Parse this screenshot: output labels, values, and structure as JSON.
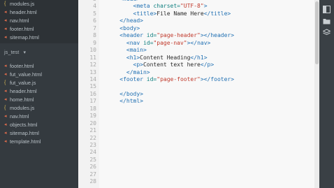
{
  "sidebar": {
    "group1_files": [
      {
        "name": "modules.js",
        "type": "js"
      },
      {
        "name": "header.html",
        "type": "html"
      },
      {
        "name": "nav.html",
        "type": "html"
      },
      {
        "name": "footer.html",
        "type": "html"
      },
      {
        "name": "sitemap.html",
        "type": "html"
      }
    ],
    "group2": {
      "title": "js_test",
      "chevron": "▾",
      "files": [
        {
          "name": "footer.html",
          "type": "html"
        },
        {
          "name": "fut_value.html",
          "type": "html"
        },
        {
          "name": "fut_value.js",
          "type": "js"
        },
        {
          "name": "header.html",
          "type": "html"
        },
        {
          "name": "home.html",
          "type": "html"
        },
        {
          "name": "modules.js",
          "type": "js"
        },
        {
          "name": "nav.html",
          "type": "html"
        },
        {
          "name": "objects.html",
          "type": "html"
        },
        {
          "name": "sitemap.html",
          "type": "html"
        },
        {
          "name": "template.html",
          "type": "html"
        }
      ]
    }
  },
  "editor": {
    "lines": [
      {
        "n": "3",
        "code": [
          [
            "    ",
            "txt"
          ],
          [
            "<head>",
            "tag"
          ]
        ]
      },
      {
        "n": "4",
        "code": [
          [
            "        ",
            "txt"
          ],
          [
            "<meta ",
            "tag"
          ],
          [
            "charset=",
            "attr"
          ],
          [
            "\"UTF-8\"",
            "str"
          ],
          [
            ">",
            "tag"
          ]
        ]
      },
      {
        "n": "5",
        "code": [
          [
            "        ",
            "txt"
          ],
          [
            "<title>",
            "tag"
          ],
          [
            "File Name Here",
            "txt"
          ],
          [
            "</title>",
            "tag"
          ]
        ]
      },
      {
        "n": "6",
        "code": [
          [
            "    ",
            "txt"
          ],
          [
            "</head>",
            "tag"
          ]
        ]
      },
      {
        "n": "7",
        "code": [
          [
            "    ",
            "txt"
          ],
          [
            "<body>",
            "tag"
          ]
        ]
      },
      {
        "n": "8",
        "code": [
          [
            "    ",
            "txt"
          ],
          [
            "<header ",
            "tag"
          ],
          [
            "id=",
            "attr"
          ],
          [
            "\"page-header\"",
            "str"
          ],
          [
            "></header>",
            "tag"
          ]
        ]
      },
      {
        "n": "9",
        "code": [
          [
            "      ",
            "txt"
          ],
          [
            "<nav ",
            "tag"
          ],
          [
            "id=",
            "attr"
          ],
          [
            "\"page-nav\"",
            "str"
          ],
          [
            "></nav>",
            "tag"
          ]
        ]
      },
      {
        "n": "10",
        "code": [
          [
            "      ",
            "txt"
          ],
          [
            "<main>",
            "tag"
          ]
        ]
      },
      {
        "n": "11",
        "code": [
          [
            "      ",
            "txt"
          ],
          [
            "<h1>",
            "tag"
          ],
          [
            "Content Heading",
            "txt"
          ],
          [
            "</h1>",
            "tag"
          ]
        ]
      },
      {
        "n": "12",
        "code": [
          [
            "        ",
            "txt"
          ],
          [
            "<p>",
            "tag"
          ],
          [
            "Content text here",
            "txt"
          ],
          [
            "</p>",
            "tag"
          ]
        ]
      },
      {
        "n": "13",
        "code": [
          [
            "      ",
            "txt"
          ],
          [
            "</main>",
            "tag"
          ]
        ]
      },
      {
        "n": "14",
        "code": [
          [
            "    ",
            "txt"
          ],
          [
            "<footer ",
            "tag"
          ],
          [
            "id=",
            "attr"
          ],
          [
            "\"page-footer\"",
            "str"
          ],
          [
            "></footer>",
            "tag"
          ]
        ]
      },
      {
        "n": "15",
        "code": []
      },
      {
        "n": "16",
        "code": [
          [
            "    ",
            "txt"
          ],
          [
            "</body>",
            "tag"
          ]
        ]
      },
      {
        "n": "17",
        "code": [
          [
            "    ",
            "txt"
          ],
          [
            "</html>",
            "tag"
          ]
        ]
      },
      {
        "n": "18",
        "code": []
      },
      {
        "n": "19",
        "code": []
      },
      {
        "n": "20",
        "code": []
      },
      {
        "n": "21",
        "code": []
      },
      {
        "n": "22",
        "code": []
      },
      {
        "n": "23",
        "code": []
      },
      {
        "n": "24",
        "code": []
      },
      {
        "n": "25",
        "code": []
      },
      {
        "n": "26",
        "code": []
      },
      {
        "n": "27",
        "code": []
      },
      {
        "n": "28",
        "code": []
      }
    ]
  },
  "toolbar": {
    "icons": [
      "panel-icon",
      "folder-icon",
      "layers-icon"
    ]
  },
  "colors": {
    "sidebar_bg": "#343a3f",
    "editor_bg": "#f8f8f8",
    "tag": "#1f6fb2",
    "attr": "#0f7f7f",
    "string": "#c0392b"
  }
}
